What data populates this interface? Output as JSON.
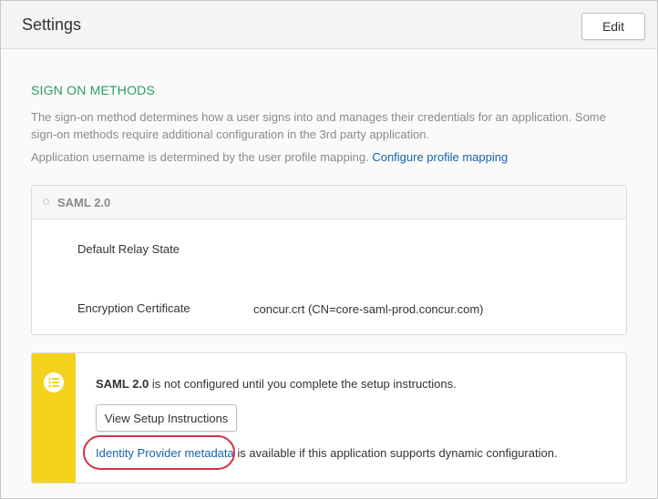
{
  "header": {
    "title": "Settings",
    "edit_label": "Edit"
  },
  "sign_on": {
    "section_title": "SIGN ON METHODS",
    "description": "The sign-on method determines how a user signs into and manages their credentials for an application. Some sign-on methods require additional configuration in the 3rd party application.",
    "username_text": "Application username is determined by the user profile mapping.",
    "username_link": "Configure profile mapping"
  },
  "saml": {
    "label": "SAML 2.0",
    "relay_label": "Default Relay State",
    "relay_value": "",
    "cert_label": "Encryption Certificate",
    "cert_value": "concur.crt (CN=core-saml-prod.concur.com)"
  },
  "notice": {
    "saml_bold": "SAML 2.0",
    "text": " is not configured until you complete the setup instructions.",
    "button_label": "View Setup Instructions",
    "metadata_link": "Identity Provider metadata",
    "metadata_text": " is available if this application supports dynamic configuration."
  },
  "colors": {
    "section_title": "#2d9b65",
    "link": "#1663a8",
    "notice_bar": "#f3d21d",
    "highlight": "#d6304a"
  }
}
